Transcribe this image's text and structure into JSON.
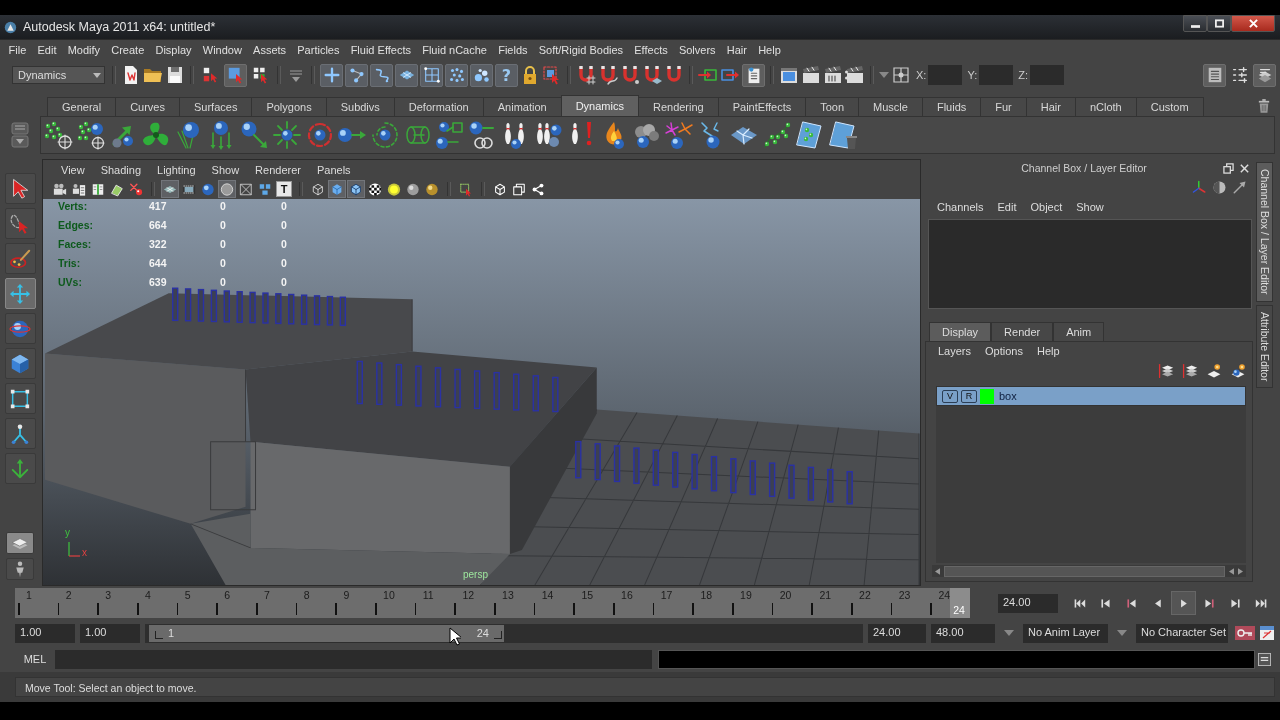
{
  "window": {
    "title": "Autodesk Maya 2011 x64: untitled*"
  },
  "menu_bar": [
    "File",
    "Edit",
    "Modify",
    "Create",
    "Display",
    "Window",
    "Assets",
    "Particles",
    "Fluid Effects",
    "Fluid nCache",
    "Fields",
    "Soft/Rigid Bodies",
    "Effects",
    "Solvers",
    "Hair",
    "Help"
  ],
  "status_line": {
    "menu_set": "Dynamics",
    "selection_modes": [
      {
        "selected": false
      },
      {
        "selected": true
      },
      {
        "selected": false
      }
    ],
    "masks": [
      {
        "on": true
      },
      {
        "on": true
      },
      {
        "on": true
      },
      {
        "on": true
      },
      {
        "on": true
      },
      {
        "on": true
      },
      {
        "on": true
      }
    ],
    "help_button": {
      "label": "?",
      "on": true
    },
    "history": {
      "on": true
    },
    "coordinates": [
      "X:",
      "Y:",
      "Z:"
    ],
    "panel_toggles": [
      {
        "on": true
      },
      {
        "on": false
      },
      {
        "on": true
      }
    ]
  },
  "shelf": {
    "tabs": [
      {
        "label": "General",
        "selected": false
      },
      {
        "label": "Curves",
        "selected": false
      },
      {
        "label": "Surfaces",
        "selected": false
      },
      {
        "label": "Polygons",
        "selected": false
      },
      {
        "label": "Subdivs",
        "selected": false
      },
      {
        "label": "Deformation",
        "selected": false
      },
      {
        "label": "Animation",
        "selected": false
      },
      {
        "label": "Dynamics",
        "selected": true
      },
      {
        "label": "Rendering",
        "selected": false
      },
      {
        "label": "PaintEffects",
        "selected": false
      },
      {
        "label": "Toon",
        "selected": false
      },
      {
        "label": "Muscle",
        "selected": false
      },
      {
        "label": "Fluids",
        "selected": false
      },
      {
        "label": "Fur",
        "selected": false
      },
      {
        "label": "Hair",
        "selected": false
      },
      {
        "label": "nCloth",
        "selected": false
      },
      {
        "label": "Custom",
        "selected": false
      }
    ]
  },
  "toolbox": [
    {
      "selected": false
    },
    {
      "selected": false
    },
    {
      "selected": false
    },
    {
      "selected": true
    },
    {
      "selected": false
    },
    {
      "selected": false
    },
    {
      "selected": false
    },
    {
      "selected": false
    },
    {
      "selected": false
    }
  ],
  "viewport": {
    "menus": [
      "View",
      "Shading",
      "Lighting",
      "Show",
      "Renderer",
      "Panels"
    ],
    "toolbar": [
      {
        "on": false
      },
      {
        "on": false
      },
      {
        "on": false
      },
      {
        "on": false
      },
      {
        "on": false
      },
      {
        "on": true
      },
      {
        "on": false
      },
      {
        "on": false
      },
      {
        "on": true
      },
      {
        "on": false
      },
      {
        "on": false
      },
      {
        "on": false,
        "label": "T"
      },
      {
        "on": false
      },
      {
        "on": true
      },
      {
        "on": true
      },
      {
        "on": false
      },
      {
        "on": false
      },
      {
        "on": false
      },
      {
        "on": false
      },
      {
        "on": false
      },
      {
        "on": false
      },
      {
        "on": false
      },
      {
        "on": false
      }
    ],
    "hud": [
      {
        "label": "Verts:",
        "values": [
          "417",
          "0",
          "0"
        ]
      },
      {
        "label": "Edges:",
        "values": [
          "664",
          "0",
          "0"
        ]
      },
      {
        "label": "Faces:",
        "values": [
          "322",
          "0",
          "0"
        ]
      },
      {
        "label": "Tris:",
        "values": [
          "644",
          "0",
          "0"
        ]
      },
      {
        "label": "UVs:",
        "values": [
          "639",
          "0",
          "0"
        ]
      }
    ],
    "axis_labels": [
      "y",
      "x"
    ],
    "camera": "persp"
  },
  "channel_box": {
    "title": "Channel Box / Layer Editor",
    "menus": [
      "Channels",
      "Edit",
      "Object",
      "Show"
    ]
  },
  "layer_editor": {
    "tabs": [
      {
        "label": "Display",
        "selected": true
      },
      {
        "label": "Render",
        "selected": false
      },
      {
        "label": "Anim",
        "selected": false
      }
    ],
    "menus": [
      "Layers",
      "Options",
      "Help"
    ],
    "layers": [
      {
        "visibility": "V",
        "render": "R",
        "color": "#00ff00",
        "name": "box",
        "selected": true
      }
    ]
  },
  "side_tabs": [
    {
      "label": "Channel Box / Layer Editor",
      "selected": true
    },
    {
      "label": "Attribute Editor",
      "selected": false
    }
  ],
  "time_slider": {
    "frames": [
      {
        "label": "1",
        "selected": false
      },
      {
        "label": "2",
        "selected": false
      },
      {
        "label": "3",
        "selected": false
      },
      {
        "label": "4",
        "selected": false
      },
      {
        "label": "5",
        "selected": false
      },
      {
        "label": "6",
        "selected": false
      },
      {
        "label": "7",
        "selected": false
      },
      {
        "label": "8",
        "selected": false
      },
      {
        "label": "9",
        "selected": false
      },
      {
        "label": "10",
        "selected": false
      },
      {
        "label": "11",
        "selected": false
      },
      {
        "label": "12",
        "selected": false
      },
      {
        "label": "13",
        "selected": false
      },
      {
        "label": "14",
        "selected": false
      },
      {
        "label": "15",
        "selected": false
      },
      {
        "label": "16",
        "selected": false
      },
      {
        "label": "17",
        "selected": false
      },
      {
        "label": "18",
        "selected": false
      },
      {
        "label": "19",
        "selected": false
      },
      {
        "label": "20",
        "selected": false
      },
      {
        "label": "21",
        "selected": false
      },
      {
        "label": "22",
        "selected": false
      },
      {
        "label": "23",
        "selected": false
      },
      {
        "label": "24",
        "selected": true
      }
    ],
    "current_frame": "24",
    "current_time": "24.00"
  },
  "playback": [
    {
      "on": false
    },
    {
      "on": false
    },
    {
      "on": false
    },
    {
      "on": false
    },
    {
      "on": true
    },
    {
      "on": false
    },
    {
      "on": false
    },
    {
      "on": false
    }
  ],
  "range_slider": {
    "start_time": "1.00",
    "playback_start": "1.00",
    "range_start": "1",
    "range_end": "24",
    "level": 0.5,
    "playback_end": "24.00",
    "end_time": "48.00",
    "anim_layer": "No Anim Layer",
    "character_set": "No Character Set"
  },
  "command_line": {
    "language": "MEL"
  },
  "help_line": "Move Tool: Select an object to move."
}
